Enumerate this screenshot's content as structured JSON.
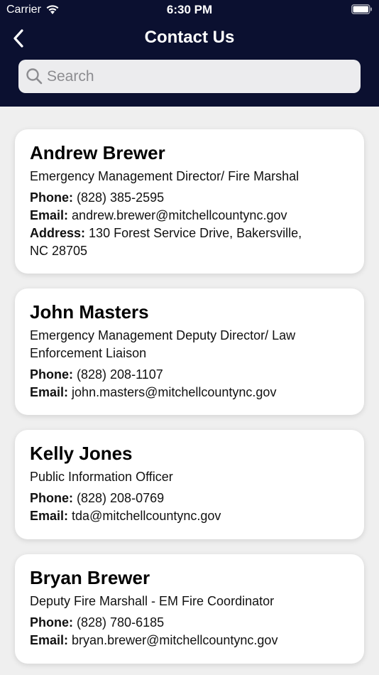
{
  "status_bar": {
    "carrier": "Carrier",
    "time": "6:30 PM"
  },
  "nav": {
    "title": "Contact Us"
  },
  "search": {
    "placeholder": "Search",
    "value": ""
  },
  "labels": {
    "phone": "Phone:",
    "email": "Email:",
    "address": "Address:"
  },
  "contacts": [
    {
      "name": "Andrew Brewer",
      "role": "Emergency Management Director/ Fire Marshal",
      "phone": "(828) 385-2595",
      "email": "andrew.brewer@mitchellcountync.gov",
      "address": "130 Forest Service Drive, Bakersville, NC 28705"
    },
    {
      "name": "John Masters",
      "role": "Emergency Management Deputy Director/ Law Enforcement Liaison",
      "phone": "(828) 208-1107",
      "email": "john.masters@mitchellcountync.gov"
    },
    {
      "name": "Kelly Jones",
      "role": "Public Information Officer",
      "phone": "(828) 208-0769",
      "email": "tda@mitchellcountync.gov"
    },
    {
      "name": "Bryan Brewer",
      "role": "Deputy Fire Marshall - EM Fire Coordinator",
      "phone": "(828) 780-6185",
      "email": "bryan.brewer@mitchellcountync.gov"
    }
  ]
}
